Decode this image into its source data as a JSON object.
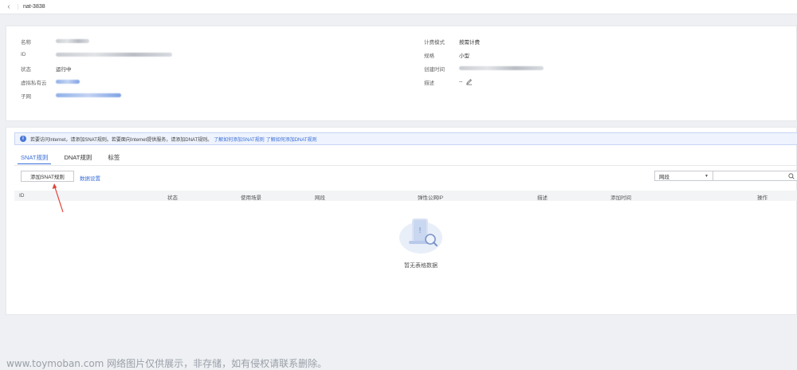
{
  "header": {
    "title": "nat-3838"
  },
  "info": {
    "left": [
      {
        "label": "名称"
      },
      {
        "label": "ID"
      },
      {
        "label": "状态",
        "value": "运行中"
      },
      {
        "label": "虚拟私有云"
      },
      {
        "label": "子网"
      }
    ],
    "right": [
      {
        "label": "计费模式",
        "value": "按需计费"
      },
      {
        "label": "规格",
        "value": "小型"
      },
      {
        "label": "创建时间"
      },
      {
        "label": "描述",
        "value": "--"
      }
    ]
  },
  "notice": {
    "text": "若要访问Internet，请添加SNAT规则。若要面向Internet提供服务，请添加DNAT规则。",
    "link1": "了解如何添加SNAT规则",
    "link2": "了解如何添加DNAT规则"
  },
  "tabs": [
    {
      "label": "SNAT规则"
    },
    {
      "label": "DNAT规则"
    },
    {
      "label": "标签"
    }
  ],
  "toolbar": {
    "add_label": "添加SNAT规则",
    "settings_label": "数据设置",
    "filter_value": "网段"
  },
  "table": {
    "columns": [
      "ID",
      "状态",
      "使用场景",
      "网段",
      "弹性公网IP",
      "描述",
      "添加时间",
      "操作"
    ]
  },
  "empty_text": "暂无表格数据",
  "watermark": "www.toymoban.com 网络图片仅供展示，非存储，如有侵权请联系删除。",
  "colors": {
    "accent": "#3a6fd8",
    "arrow": "#e0443a"
  }
}
